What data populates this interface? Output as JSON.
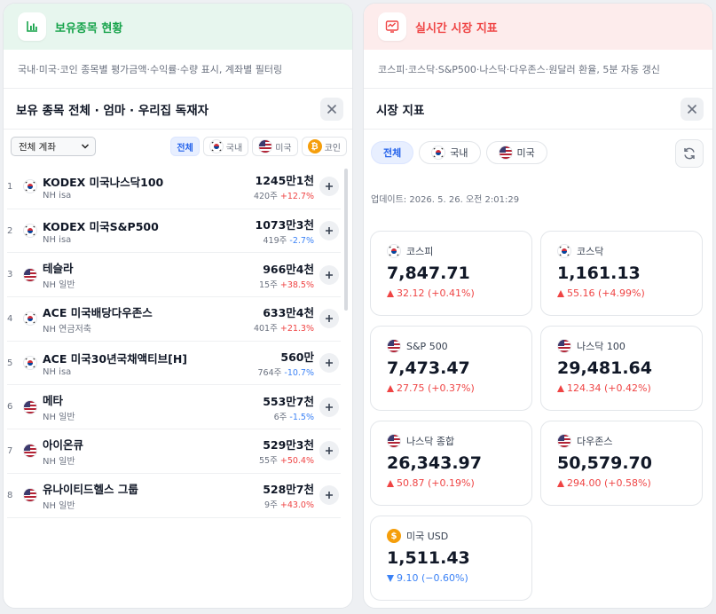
{
  "colors": {
    "green": "#16a34a",
    "red": "#ef4444",
    "blue": "#3b82f6",
    "accent": "#2563eb"
  },
  "holdings_panel": {
    "title": "보유종목 현황",
    "icon": "bar-chart-icon",
    "description": "국내·미국·코인 종목별 평가금액·수익률·수량 표시, 계좌별 필터링",
    "subtitle": "보유 종목 전체 · 엄마 · 우리집 독재자",
    "account_select": "전체 계좌",
    "tabs": [
      {
        "label": "전체",
        "icon": ""
      },
      {
        "label": "국내",
        "icon": "kr-flag-icon"
      },
      {
        "label": "미국",
        "icon": "us-flag-icon"
      },
      {
        "label": "코인",
        "icon": "bitcoin-icon"
      }
    ],
    "rows": [
      {
        "rank": "1",
        "flag": "kr",
        "name": "KODEX 미국나스닥100",
        "account": "NH isa",
        "value": "1245만1천",
        "qty": "420주",
        "ret": "+12.7%",
        "dir": "up"
      },
      {
        "rank": "2",
        "flag": "kr",
        "name": "KODEX 미국S&P500",
        "account": "NH isa",
        "value": "1073만3천",
        "qty": "419주",
        "ret": "-2.7%",
        "dir": "down"
      },
      {
        "rank": "3",
        "flag": "us",
        "name": "테슬라",
        "account": "NH 일반",
        "value": "966만4천",
        "qty": "15주",
        "ret": "+38.5%",
        "dir": "up"
      },
      {
        "rank": "4",
        "flag": "kr",
        "name": "ACE 미국배당다우존스",
        "account": "NH 연금저축",
        "value": "633만4천",
        "qty": "401주",
        "ret": "+21.3%",
        "dir": "up"
      },
      {
        "rank": "5",
        "flag": "kr",
        "name": "ACE 미국30년국채액티브[H]",
        "account": "NH isa",
        "value": "560만",
        "qty": "764주",
        "ret": "-10.7%",
        "dir": "down"
      },
      {
        "rank": "6",
        "flag": "us",
        "name": "메타",
        "account": "NH 일반",
        "value": "553만7천",
        "qty": "6주",
        "ret": "-1.5%",
        "dir": "down"
      },
      {
        "rank": "7",
        "flag": "us",
        "name": "아이온큐",
        "account": "NH 일반",
        "value": "529만3천",
        "qty": "55주",
        "ret": "+50.4%",
        "dir": "up"
      },
      {
        "rank": "8",
        "flag": "us",
        "name": "유나이티드헬스 그룹",
        "account": "NH 일반",
        "value": "528만7천",
        "qty": "9주",
        "ret": "+43.0%",
        "dir": "up"
      }
    ]
  },
  "market_panel": {
    "title": "실시간 시장 지표",
    "icon": "activity-chart-icon",
    "description": "코스피·코스닥·S&P500·나스닥·다우존스·원달러 환율, 5분 자동 갱신",
    "subtitle": "시장 지표",
    "tabs": [
      {
        "label": "전체",
        "icon": ""
      },
      {
        "label": "국내",
        "icon": "kr-flag-icon"
      },
      {
        "label": "미국",
        "icon": "us-flag-icon"
      }
    ],
    "updated": "업데이트: 2026. 5. 26. 오전 2:01:29",
    "cards": [
      {
        "flag": "kr",
        "name": "코스피",
        "value": "7,847.71",
        "change": "32.12 (+0.41%)",
        "dir": "up"
      },
      {
        "flag": "kr",
        "name": "코스닥",
        "value": "1,161.13",
        "change": "55.16 (+4.99%)",
        "dir": "up"
      },
      {
        "flag": "us",
        "name": "S&P 500",
        "value": "7,473.47",
        "change": "27.75 (+0.37%)",
        "dir": "up"
      },
      {
        "flag": "us",
        "name": "나스닥 100",
        "value": "29,481.64",
        "change": "124.34 (+0.42%)",
        "dir": "up"
      },
      {
        "flag": "us",
        "name": "나스닥 종합",
        "value": "26,343.97",
        "change": "50.87 (+0.19%)",
        "dir": "up"
      },
      {
        "flag": "us",
        "name": "다우존스",
        "value": "50,579.70",
        "change": "294.00 (+0.58%)",
        "dir": "up"
      },
      {
        "flag": "coin",
        "coin_symbol": "$",
        "name": "미국 USD",
        "value": "1,511.43",
        "change": "9.10 (−0.60%)",
        "dir": "down"
      }
    ]
  }
}
